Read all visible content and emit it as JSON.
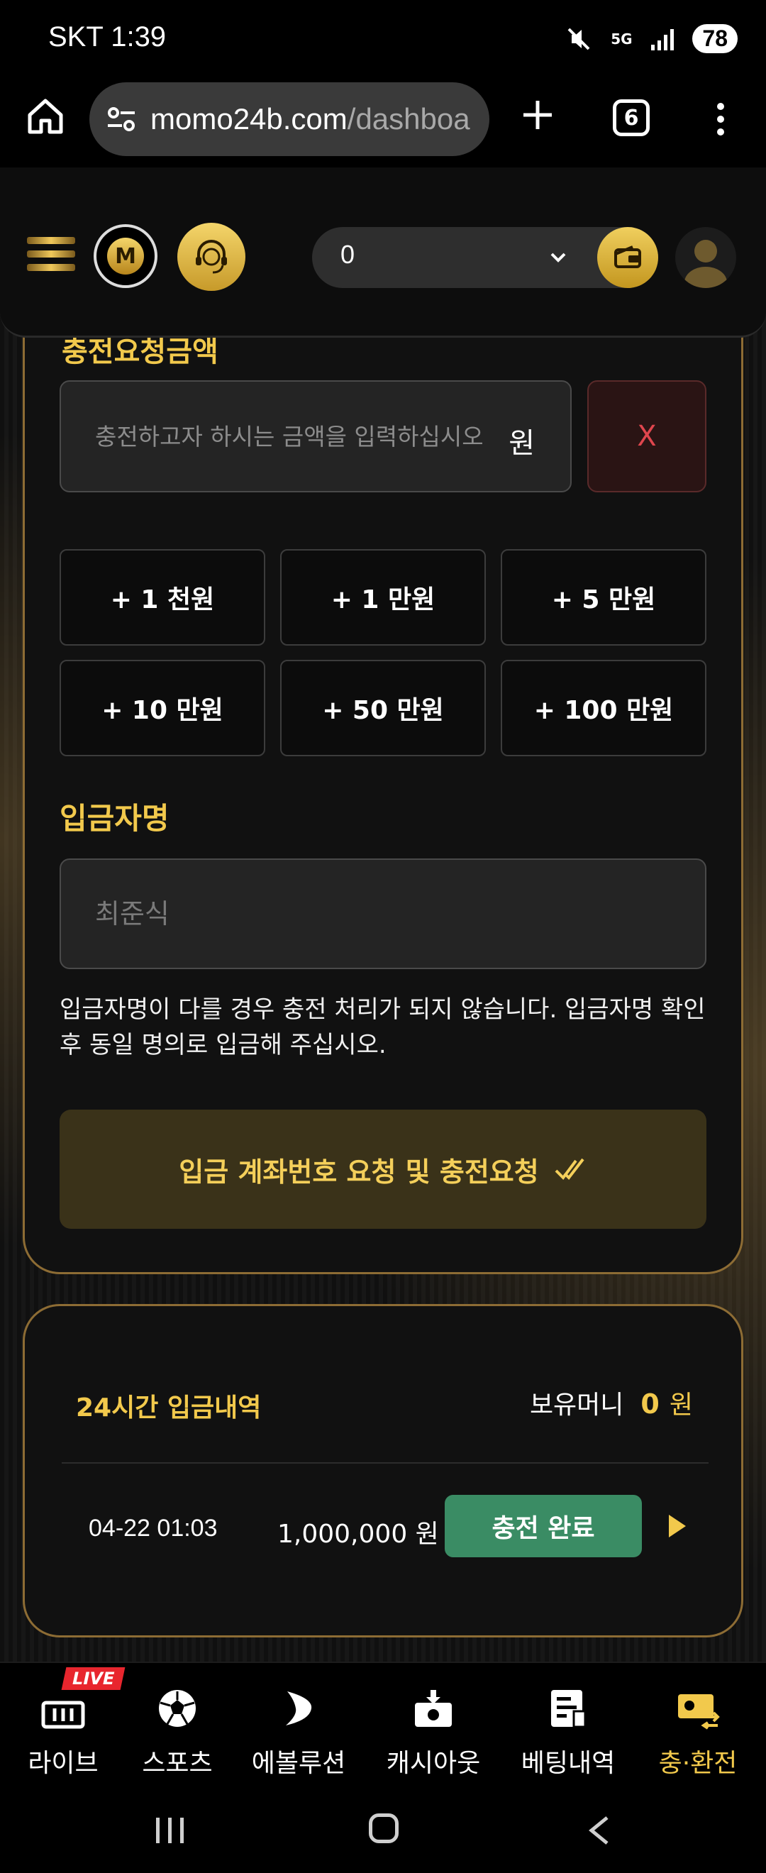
{
  "status_bar": {
    "carrier": "SKT",
    "time": "1:39",
    "network": "5G",
    "battery": "78"
  },
  "browser": {
    "url_host": "momo24b.com",
    "url_path": "/dashboa",
    "tab_count": "6"
  },
  "header": {
    "balance_value": "0"
  },
  "deposit": {
    "section_peek": "충전요청금액",
    "amount_placeholder": "충전하고자 하시는 금액을 입력하십시오",
    "amount_unit": "원",
    "clear_label": "X",
    "quick_amounts": [
      "+ 1 천원",
      "+ 1 만원",
      "+ 5 만원",
      "+ 10 만원",
      "+ 50 만원",
      "+ 100 만원"
    ],
    "depositor_label": "입금자명",
    "depositor_placeholder": "최준식",
    "notice": "입금자명이 다를 경우 충전 처리가 되지 않습니다. 입금자명 확인 후 동일 명의로 입금해 주십시오.",
    "submit_label": "입금 계좌번호 요청 및 충전요청"
  },
  "history": {
    "title": "24시간 입금내역",
    "balance_label": "보유머니",
    "balance_value": "0",
    "balance_unit": "원",
    "rows": [
      {
        "date": "04-22 01:03",
        "amount": "1,000,000 원",
        "status": "충전 완료"
      }
    ]
  },
  "bottom_nav": {
    "live_badge": "LIVE",
    "items": [
      {
        "label": "라이브",
        "icon": "stadium-icon"
      },
      {
        "label": "스포츠",
        "icon": "soccer-ball-icon"
      },
      {
        "label": "에볼루션",
        "icon": "evolution-icon"
      },
      {
        "label": "캐시아웃",
        "icon": "cashout-icon"
      },
      {
        "label": "베팅내역",
        "icon": "betting-history-icon"
      },
      {
        "label": "충·환전",
        "icon": "exchange-icon"
      }
    ],
    "active_index": 5
  },
  "colors": {
    "accent_gold": "#f2c94c",
    "card_border": "#8d6c34",
    "status_green": "#3a8c64",
    "danger_red": "#e0464e"
  }
}
